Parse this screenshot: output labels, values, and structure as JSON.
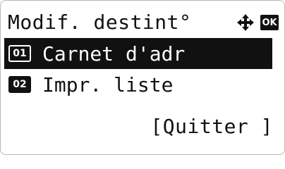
{
  "header": {
    "title": "Modif. destint°",
    "nav_icon": "four-way-arrow-icon",
    "ok_label": "OK"
  },
  "menu": {
    "items": [
      {
        "number": "01",
        "label": "Carnet d'adr",
        "selected": true
      },
      {
        "number": "02",
        "label": "Impr. liste",
        "selected": false
      }
    ]
  },
  "softkeys": {
    "right_label": "[Quitter ]"
  },
  "colors": {
    "foreground": "#111111",
    "background": "#ffffff",
    "highlight": "#111111"
  }
}
